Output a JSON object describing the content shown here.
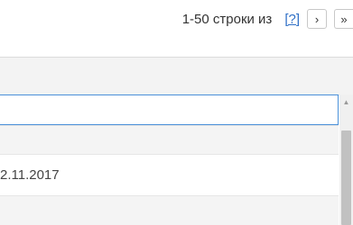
{
  "pager": {
    "range_text": "1-50 строки из",
    "total_link": "[?]",
    "next_button": "›",
    "last_button": "»"
  },
  "grid": {
    "rows": [
      {
        "date": ""
      },
      {
        "date": "2.11.2017"
      },
      {
        "date": ""
      }
    ]
  },
  "scrollbar": {
    "up_arrow": "▲"
  }
}
